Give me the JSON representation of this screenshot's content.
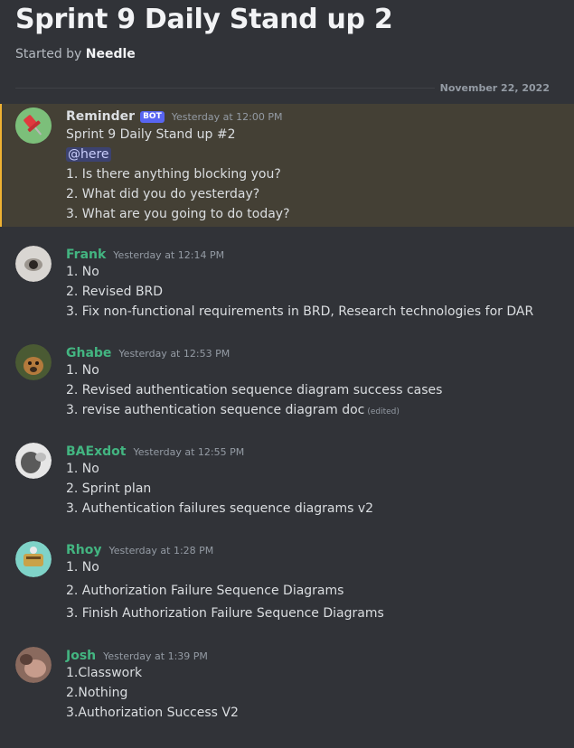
{
  "thread": {
    "title": "Sprint 9 Daily Stand up 2",
    "started_prefix": "Started by",
    "started_by": "Needle",
    "date_divider": "November 22, 2022"
  },
  "messages": [
    {
      "author": "Reminder",
      "author_color": "#dbdee1",
      "bot_tag": "BOT",
      "time": "Yesterday at 12:00 PM",
      "lines": [
        "Sprint 9 Daily Stand up #2",
        "@here",
        "1. Is there anything blocking you?",
        "2. What did you do yesterday?",
        "3. What are you going to do today?"
      ],
      "avatar_icon": "pushpin-icon"
    },
    {
      "author": "Frank",
      "author_color": "#43b581",
      "time": "Yesterday at 12:14 PM",
      "lines": [
        "1. No",
        "2. Revised BRD",
        "3. Fix non-functional requirements in BRD, Research technologies for DAR"
      ]
    },
    {
      "author": "Ghabe",
      "author_color": "#43b581",
      "time": "Yesterday at 12:53 PM",
      "lines": [
        "1. No",
        "2. Revised authentication sequence diagram success cases",
        "3. revise authentication sequence diagram doc"
      ],
      "edited": "(edited)"
    },
    {
      "author": "BAExdot",
      "author_color": "#43b581",
      "time": "Yesterday at 12:55 PM",
      "lines": [
        "1. No",
        "2. Sprint plan",
        "3. Authentication failures sequence diagrams v2"
      ]
    },
    {
      "author": "Rhoy",
      "author_color": "#43b581",
      "time": "Yesterday at 1:28 PM",
      "lines": [
        "1. No",
        "2. Authorization Failure Sequence Diagrams",
        "3. Finish Authorization Failure Sequence Diagrams"
      ]
    },
    {
      "author": "Josh",
      "author_color": "#43b581",
      "time": "Yesterday at 1:39 PM",
      "lines": [
        "1.Classwork",
        "2.Nothing",
        "3.Authorization Success V2"
      ]
    }
  ]
}
